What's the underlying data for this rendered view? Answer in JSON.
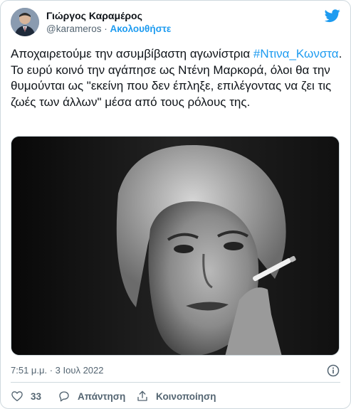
{
  "author": {
    "display_name": "Γιώργος Καραμέρος",
    "handle": "@karameros",
    "separator": "·",
    "follow_label": "Ακολουθήστε"
  },
  "tweet": {
    "text_before": "Αποχαιρετούμε την ασυμβίβαστη αγωνίστρια ",
    "hashtag": "#Ντινα_Κωνστα",
    "text_after": ". Το ευρύ κοινό την αγάπησε ως Ντένη Μαρκορά, όλοι θα την θυμούνται ως \"εκείνη που δεν έπληξε, επιλέγοντας να ζει τις ζωές των άλλων\" μέσα από τους ρόλους της."
  },
  "meta": {
    "timestamp": "7:51 μ.μ. · 3 Ιουλ 2022"
  },
  "actions": {
    "like_count": "33",
    "reply_label": "Απάντηση",
    "share_label": "Κοινοποίηση"
  },
  "colors": {
    "accent": "#1d9bf0",
    "text": "#0f1419",
    "muted": "#536471",
    "border": "#cfd9de"
  },
  "icons": [
    "twitter-bird-icon",
    "info-icon",
    "heart-icon",
    "reply-icon",
    "share-icon"
  ]
}
